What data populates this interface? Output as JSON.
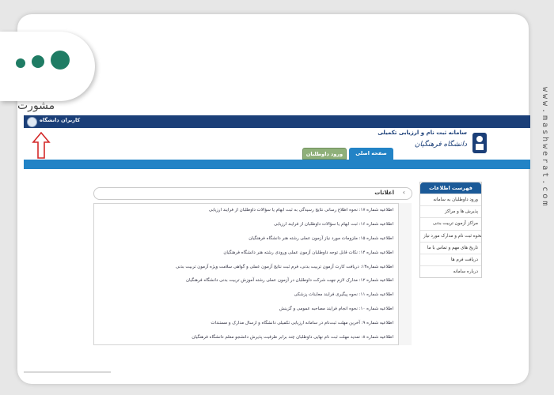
{
  "watermark": "www.mashwerat.com",
  "logo": {
    "text": "مشورت"
  },
  "topbar": {
    "user_label": "کاربران دانشگاه"
  },
  "brand": {
    "title": "سامانه ثبت نام و ارزیابی تکمیلی",
    "name": "دانشگاه فرهنگیان"
  },
  "tabs": [
    {
      "label": "صفحه اصلی",
      "active": true
    },
    {
      "label": "ورود داوطلبان",
      "active": false
    }
  ],
  "menu": {
    "title": "فهرست اطلاعات",
    "items": [
      "ورود داوطلبان به سامانه",
      "پذیرش ها و مراکز",
      "مراکز آزمون تربیت بدنی",
      "نحوه ثبت نام و مدارک مورد نیاز",
      "تاریخ های مهم و تماس با ما",
      "دریافت فرم ها",
      "درباره سامانه"
    ]
  },
  "news": {
    "title": "اعلانات",
    "items": [
      "اطلاعیه شماره ۱۷: نحوه اطلاع رسانی نتایج رسیدگی به ثبت ابهام یا سؤالات داوطلبان از فرایند ارزیابی",
      "اطلاعیه شماره ۱۶: ثبت ابهام یا سؤالات داوطلبان از فرایند ارزیابی",
      "اطلاعیه شماره ۱۵: ملزومات مورد نیاز آزمون عملی رشته هنر دانشگاه فرهنگیان",
      "اطلاعیه شماره ۱۴: نکات قابل توجه داوطلبان آزمون عملی ورودی رشته هنر دانشگاه فرهنگیان",
      "اطلاعیه شماره۱۳: دریافت کارت آزمون تربیت بدنی، فرم ثبت نتایج آزمون عملی و گواهی سلامت ویژه آزمون تربیت بدنی",
      "اطلاعیه شماره ۱۲: مدارک لازم جهت شرکت داوطلبان در آزمون عملی رشته آموزش تربیت بدنی دانشگاه فرهنگیان",
      "اطلاعیه شماره ۱۱: نحوه پیگیری فرایند معاینات پزشکی",
      "اطلاعیه شماره ۱۰: نحوه انجام فرایند مصاحبه عمومی و گزینش",
      "اطلاعیه شماره ۹: آخرین مهلت ثبت‌نام در سامانه ارزیابی تکمیلی دانشگاه و ارسال مدارک و مستندات",
      "اطلاعیه شماره ۸: تمدید مهلت ثبت نام نهایی داوطلبان چند برابر ظرفیت پذیرش دانشجو معلم دانشگاه فرهنگیان"
    ]
  },
  "colors": {
    "navy": "#1b3f78",
    "blue": "#2283c6",
    "green_tab": "#8fb07a",
    "logo_green": "#1f7c64",
    "arrow": "#d42a2a"
  }
}
